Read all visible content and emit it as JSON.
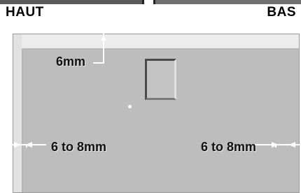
{
  "header": {
    "left_label": "HAUT",
    "right_label": "BAS"
  },
  "diagram": {
    "margin_top": "6mm",
    "margin_left": "6 to 8mm",
    "margin_right": "6 to 8mm"
  }
}
